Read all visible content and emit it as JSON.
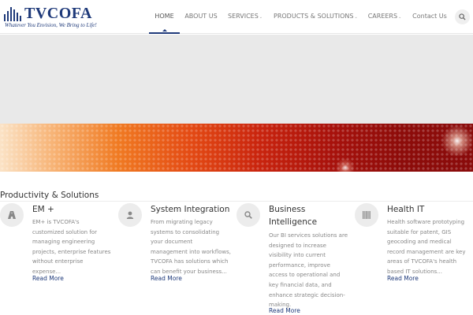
{
  "brand": {
    "name": "TVCOFA",
    "tagline": "Whatever You Envision, We Bring to Life!",
    "color": "#1f3a7a"
  },
  "nav": {
    "items": [
      {
        "label": "HOME",
        "active": true,
        "has_dropdown": false
      },
      {
        "label": "ABOUT US",
        "active": false,
        "has_dropdown": false
      },
      {
        "label": "SERVICES",
        "active": false,
        "has_dropdown": true
      },
      {
        "label": "PRODUCTS & SOLUTIONS",
        "active": false,
        "has_dropdown": true
      },
      {
        "label": "CAREERS",
        "active": false,
        "has_dropdown": true
      },
      {
        "label": "Contact Us",
        "active": false,
        "has_dropdown": false
      }
    ],
    "caret": "⌄",
    "search_icon": "search-icon"
  },
  "section": {
    "title": "Productivity & Solutions"
  },
  "cards": [
    {
      "icon": "road-icon",
      "title": "EM +",
      "lines": [
        "EM+ is TVCOFA's",
        "customized solution for",
        "managing engineering",
        "projects, enterprise features",
        "without enterprise",
        "expense..."
      ],
      "more": "Read More"
    },
    {
      "icon": "user-icon",
      "title": "System Integration",
      "lines": [
        "From migrating legacy",
        "systems to consolidating",
        "your document",
        "management into workflows,",
        "TVCOFA has solutions which",
        "can benefit your business..."
      ],
      "more": "Read More"
    },
    {
      "icon": "search-icon",
      "title_lines": [
        "Business",
        "Intelligence"
      ],
      "lines": [
        "Our BI services solutions are",
        "designed to increase",
        "visibility into current",
        "performance, improve",
        "access to operational and",
        "key financial data, and",
        "enhance strategic decision-",
        "making."
      ],
      "more": "Read More"
    },
    {
      "icon": "barcode-icon",
      "title": "Health IT",
      "lines": [
        "Health software prototyping",
        "suitable for patent, GIS",
        "geocoding and medical",
        "record management are key",
        "areas of TVCOFA's health",
        "based IT solutions..."
      ],
      "more": "Read More"
    }
  ]
}
